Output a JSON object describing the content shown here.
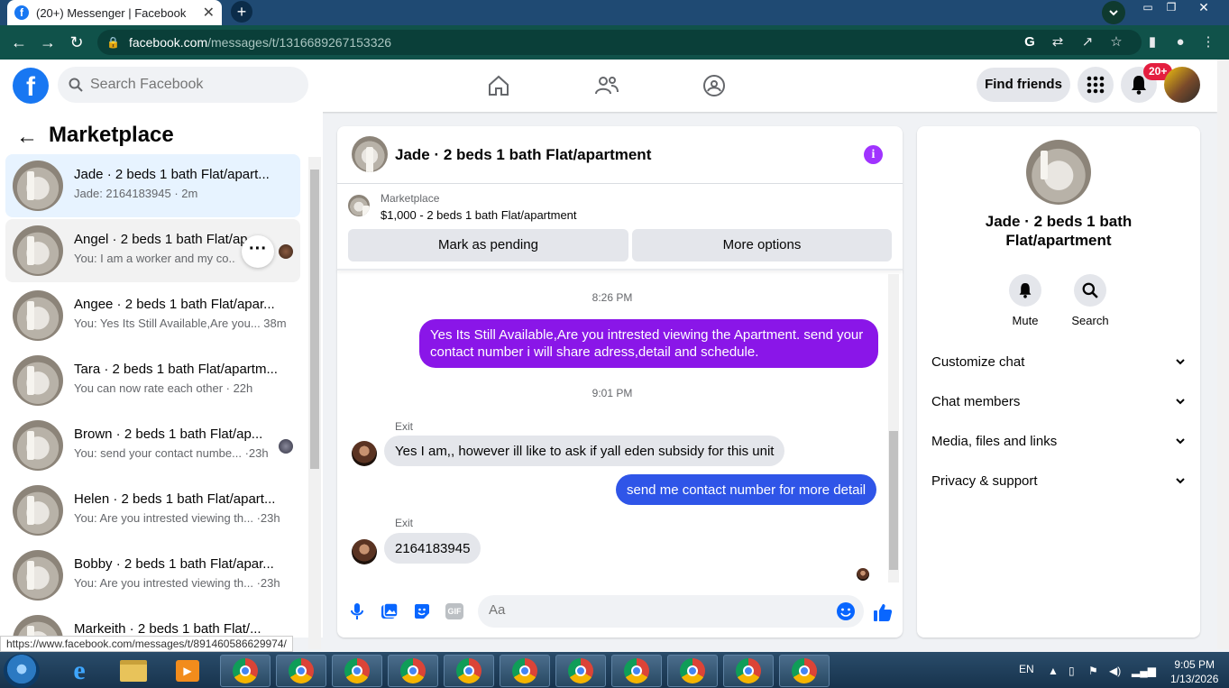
{
  "browser": {
    "tab_title": "(20+) Messenger | Facebook",
    "url_host": "facebook.com",
    "url_path": "/messages/t/1316689267153326",
    "status_url": "https://www.facebook.com/messages/t/891460586629974/"
  },
  "header": {
    "search_placeholder": "Search Facebook",
    "find_friends": "Find friends",
    "notif_badge": "20+"
  },
  "sidebar": {
    "title": "Marketplace",
    "conversations": [
      {
        "name": "Jade · 2 beds 1 bath Flat/apart...",
        "preview": "Jade: 2164183945 · 2m"
      },
      {
        "name": "Angel · 2 beds 1 bath Flat/ap",
        "preview": "You: I am a worker and my co..."
      },
      {
        "name": "Angee · 2 beds 1 bath Flat/apar...",
        "preview": "You: Yes Its Still Available,Are you...  38m"
      },
      {
        "name": "Tara · 2 beds 1 bath Flat/apartm...",
        "preview": "You can now rate each other · 22h"
      },
      {
        "name": "Brown · 2 beds 1 bath Flat/ap...",
        "preview": "You: send your contact numbe... ·23h"
      },
      {
        "name": "Helen · 2 beds 1 bath Flat/apart...",
        "preview": "You: Are you intrested viewing th... ·23h"
      },
      {
        "name": "Bobby · 2 beds 1 bath Flat/apar...",
        "preview": "You: Are you intrested viewing th... ·23h"
      },
      {
        "name": "Markeith · 2 beds 1 bath Flat/...",
        "preview": ""
      }
    ]
  },
  "chat": {
    "title": "Jade · 2 beds 1 bath Flat/apartment",
    "marketplace_label": "Marketplace",
    "listing": "$1,000 - 2 beds 1 bath Flat/apartment",
    "mark_pending": "Mark as pending",
    "more_options": "More options",
    "time1": "8:26 PM",
    "msg1": "Yes Its Still Available,Are you intrested viewing the Apartment. send your contact number i will share adress,detail and schedule.",
    "time2": "9:01 PM",
    "exit_label1": "Exit",
    "msg2": "Yes I am,, however ill like to ask if yall eden subsidy for this unit",
    "msg3": "send me contact number for more detail",
    "exit_label2": "Exit",
    "msg4": "2164183945",
    "composer_placeholder": "Aa",
    "gif_label": "GIF"
  },
  "details": {
    "title": "Jade · 2 beds 1 bath Flat/apartment",
    "mute": "Mute",
    "search": "Search",
    "rows": [
      "Customize chat",
      "Chat members",
      "Media, files and links",
      "Privacy & support"
    ]
  },
  "taskbar": {
    "lang": "EN",
    "time": "9:05 PM",
    "date": "1/13/2026"
  },
  "colors": {
    "fb_blue": "#1877f2",
    "messenger_purple": "#8a16e8",
    "messenger_blue": "#2f55e8"
  }
}
